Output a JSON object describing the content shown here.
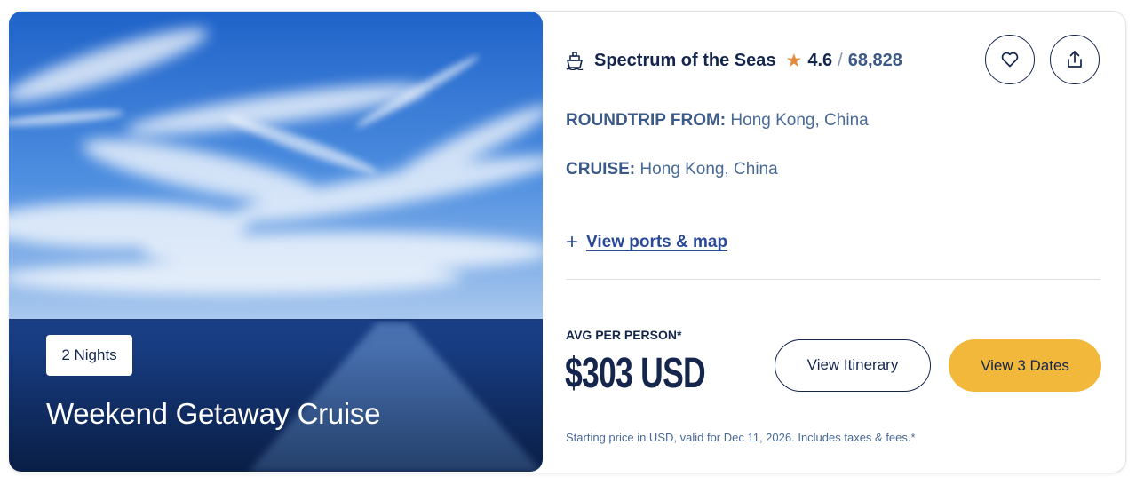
{
  "hero": {
    "nights_badge": "2 Nights",
    "title": "Weekend Getaway Cruise"
  },
  "ship": {
    "icon": "ship-icon",
    "name": "Spectrum of the Seas",
    "rating_icon": "star-icon",
    "rating": "4.6",
    "rating_separator": "/",
    "review_count": "68,828"
  },
  "actions": {
    "favorite_icon": "heart-icon",
    "share_icon": "share-icon"
  },
  "details": {
    "roundtrip_label": "ROUNDTRIP FROM:",
    "roundtrip_value": "Hong Kong, China",
    "cruise_label": "CRUISE:",
    "cruise_value": "Hong Kong, China",
    "ports_link": "View ports & map"
  },
  "pricing": {
    "label": "AVG PER PERSON*",
    "price": "$303 USD",
    "fineprint": "Starting price in USD, valid for Dec 11, 2026. Includes taxes & fees.*"
  },
  "buttons": {
    "itinerary": "View Itinerary",
    "dates": "View 3 Dates"
  },
  "colors": {
    "navy": "#15264c",
    "accent_yellow": "#f2b83b",
    "star_orange": "#e48a3a",
    "link_blue": "#2a4a99"
  }
}
